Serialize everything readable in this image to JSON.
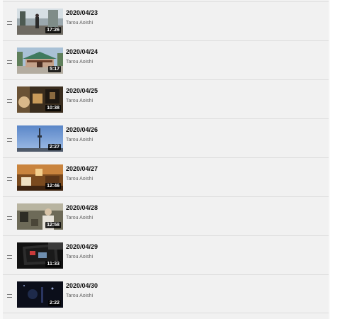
{
  "playlist": {
    "items": [
      {
        "title": "2020/04/23",
        "channel": "Tarou Aoishi",
        "duration": "17:26",
        "thumb": "street-scene"
      },
      {
        "title": "2020/04/24",
        "channel": "Tarou Aoishi",
        "duration": "5:17",
        "thumb": "shrine-building"
      },
      {
        "title": "2020/04/25",
        "channel": "Tarou Aoishi",
        "duration": "10:38",
        "thumb": "dim-room"
      },
      {
        "title": "2020/04/26",
        "channel": "Tarou Aoishi",
        "duration": "2:27",
        "thumb": "sky-tower"
      },
      {
        "title": "2020/04/27",
        "channel": "Tarou Aoishi",
        "duration": "12:46",
        "thumb": "warm-room"
      },
      {
        "title": "2020/04/28",
        "channel": "Tarou Aoishi",
        "duration": "12:58",
        "thumb": "person-indoors"
      },
      {
        "title": "2020/04/29",
        "channel": "Tarou Aoishi",
        "duration": "11:33",
        "thumb": "dark-screen"
      },
      {
        "title": "2020/04/30",
        "channel": "Tarou Aoishi",
        "duration": "2:22",
        "thumb": "night-scene"
      }
    ]
  }
}
